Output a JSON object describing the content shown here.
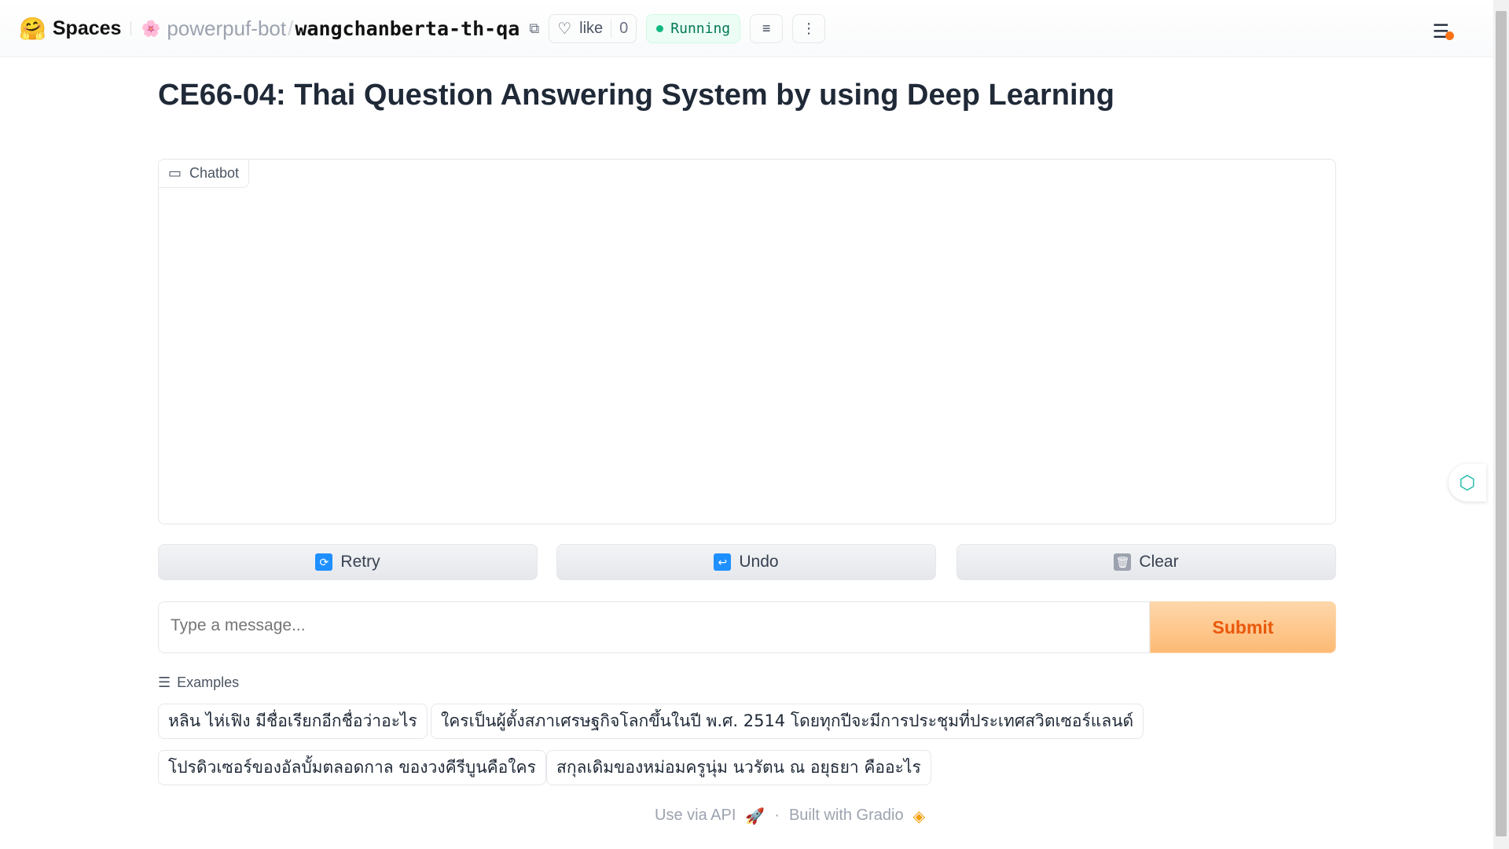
{
  "header": {
    "brand": "Spaces",
    "owner": "powerpuf-bot",
    "repo": "wangchanberta-th-qa",
    "like_label": "like",
    "like_count": "0",
    "status": "Running"
  },
  "title": "CE66-04: Thai Question Answering System by using Deep Learning",
  "chatbot": {
    "label": "Chatbot"
  },
  "buttons": {
    "retry": "Retry",
    "undo": "Undo",
    "clear": "Clear",
    "submit": "Submit"
  },
  "input": {
    "placeholder": "Type a message..."
  },
  "examples": {
    "label": "Examples",
    "items": [
      "หลิน ไห่เฟิง มีชื่อเรียกอีกชื่อว่าอะไร",
      "ใครเป็นผู้ตั้งสภาเศรษฐกิจโลกขึ้นในปี พ.ศ. 2514 โดยทุกปีจะมีการประชุมที่ประเทศสวิตเซอร์แลนด์",
      "โปรดิวเซอร์ของอัลบั้มตลอดกาล ของวงคีรีบูนคือใคร",
      "สกุลเดิมของหม่อมครูนุ่ม นวรัตน ณ อยุธยา คืออะไร"
    ]
  },
  "footer": {
    "api": "Use via API",
    "separator": "·",
    "built": "Built with Gradio"
  }
}
